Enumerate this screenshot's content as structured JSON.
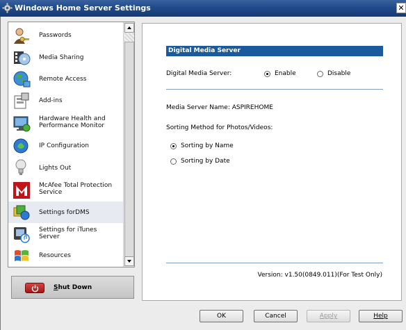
{
  "window": {
    "title": "Windows Home Server Settings",
    "close_glyph": "✕"
  },
  "sidebar": {
    "items": [
      {
        "label": "Passwords",
        "icon": "user-key-icon"
      },
      {
        "label": "Media Sharing",
        "icon": "media-sharing-icon"
      },
      {
        "label": "Remote Access",
        "icon": "globe-icon"
      },
      {
        "label": "Add-ins",
        "icon": "add-ins-icon"
      },
      {
        "label": "Hardware Health and Performance Monitor",
        "label_line1": "Hardware Health and",
        "label_line2": "Performance Monitor",
        "icon": "monitor-icon"
      },
      {
        "label": "IP Configuration",
        "icon": "network-icon"
      },
      {
        "label": "Lights Out",
        "icon": "lightbulb-icon"
      },
      {
        "label": "McAfee Total Protection Service",
        "label_line1": "McAfee Total Protection",
        "label_line2": "Service",
        "icon": "mcafee-icon"
      },
      {
        "label": "Settings forDMS",
        "icon": "dms-icon",
        "selected": true
      },
      {
        "label": "Settings for iTunes Server",
        "label_line1": "Settings for iTunes",
        "label_line2": "Server",
        "icon": "itunes-icon"
      },
      {
        "label": "Resources",
        "icon": "windows-logo-icon"
      }
    ]
  },
  "shutdown": {
    "label": "Shut Down",
    "accel": "S",
    "rest": "hut Down"
  },
  "panel": {
    "header": "Digital Media Server",
    "dms_label": "Digital Media Server:",
    "enable_label": "Enable",
    "disable_label": "Disable",
    "enable_selected": true,
    "media_server_name": "Media Server Name: ASPIREHOME",
    "sorting_label": "Sorting Method for Photos/Videos:",
    "sort_by_name": "Sorting by Name",
    "sort_by_date": "Sorting by Date",
    "sort_selected": "name",
    "version": "Version: v1.50(0849.011)(For Test Only)"
  },
  "buttons": {
    "ok": "OK",
    "cancel": "Cancel",
    "apply": "Apply",
    "help": "Help"
  }
}
